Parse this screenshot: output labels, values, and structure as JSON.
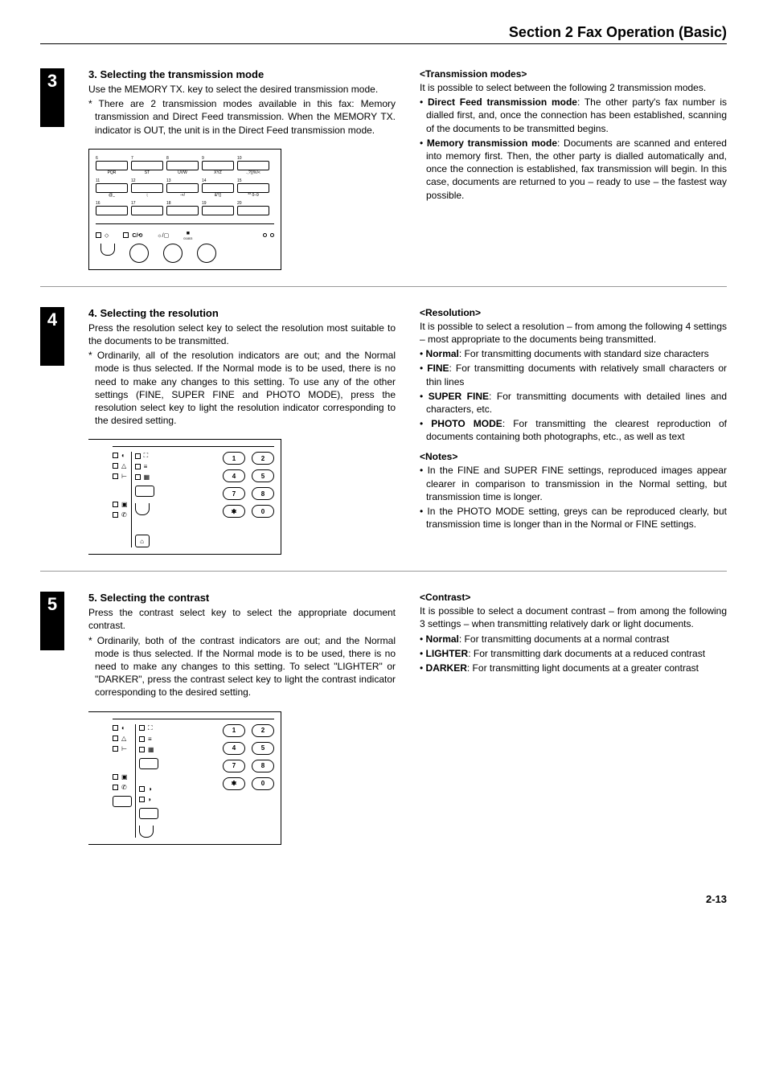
{
  "header": "Section 2   Fax Operation (Basic)",
  "step3": {
    "num": "3",
    "title": "3. Selecting the transmission mode",
    "body": "Use the MEMORY TX. key to select the desired transmission mode.",
    "note": "* There are 2 transmission modes available in this fax: Memory transmission and Direct Feed transmission. When the MEMORY TX. indicator is OUT, the unit is in the Direct Feed transmission mode.",
    "right_title": "<Transmission modes>",
    "right_intro": "It is possible to select between the following 2 transmission modes.",
    "bullets": [
      {
        "b": "Direct Feed transmission mode",
        "t": ": The other party's fax number is dialled first, and, once the connection has been established, scanning of the documents to be transmitted begins."
      },
      {
        "b": "Memory transmission mode",
        "t": ": Documents are scanned and entered into memory first. Then, the other party is dialled automatically and, once the connection is established, fax transmission will begin. In this case, documents are returned to you – ready to use – the fastest way possible."
      }
    ]
  },
  "step4": {
    "num": "4",
    "title": "4. Selecting the resolution",
    "body": "Press the resolution select key to select the resolution most suitable to the documents to be transmitted.",
    "note": "* Ordinarily, all of the resolution indicators are out; and the Normal mode is thus selected. If the Normal mode is to be used, there is no need to make any changes to this setting. To use any of the other settings (FINE, SUPER FINE and PHOTO MODE), press the resolution select key to light the resolution indicator corresponding to the desired setting.",
    "right_title": "<Resolution>",
    "right_intro": "It is possible to select a resolution – from among the following 4 settings – most appropriate to the documents being transmitted.",
    "bullets": [
      {
        "b": "Normal",
        "t": ": For transmitting documents with standard size characters"
      },
      {
        "b": "FINE",
        "t": ": For transmitting documents with relatively small characters or thin lines"
      },
      {
        "b": "SUPER FINE",
        "t": ": For transmitting documents with detailed lines and characters, etc."
      },
      {
        "b": "PHOTO MODE",
        "t": ": For transmitting the clearest reproduction of documents containing both photographs, etc., as well as text"
      }
    ],
    "notes_title": "<Notes>",
    "notes": [
      "In the FINE and SUPER FINE settings, reproduced images appear clearer in comparison to transmission in the Normal setting, but transmission time is longer.",
      "In the PHOTO MODE setting, greys can be reproduced clearly, but transmission time is longer than in the Normal or FINE settings."
    ]
  },
  "step5": {
    "num": "5",
    "title": "5. Selecting the contrast",
    "body": "Press the contrast select key to select the appropriate document contrast.",
    "note": "* Ordinarily, both of the contrast indicators are out; and the Normal mode is thus selected. If the Normal mode is to be used, there is no need to make any changes to this setting. To select \"LIGHTER\" or \"DARKER\", press the contrast select key to light the contrast indicator corresponding to the desired setting.",
    "right_title": "<Contrast>",
    "right_intro": "It is possible to select a document contrast – from among the following 3 settings – when transmitting relatively dark or light documents.",
    "bullets": [
      {
        "b": "Normal",
        "t": ": For transmitting documents at a normal contrast"
      },
      {
        "b": "LIGHTER",
        "t": ": For transmitting dark documents at a reduced contrast"
      },
      {
        "b": "DARKER",
        "t": ": For transmitting light documents at a greater contrast"
      }
    ]
  },
  "page_num": "2-13",
  "keypad": {
    "row1": [
      {
        "n": "6",
        "l": "PQR"
      },
      {
        "n": "7",
        "l": "ST"
      },
      {
        "n": "8",
        "l": "UVW"
      },
      {
        "n": "9",
        "l": "XYZ"
      },
      {
        "n": "10",
        "l": ".,?()%!<"
      }
    ],
    "row2": [
      {
        "n": "11",
        "l": "@_"
      },
      {
        "n": "12",
        "l": ":;"
      },
      {
        "n": "13",
        "l": "-+/"
      },
      {
        "n": "14",
        "l": "&*()"
      },
      {
        "n": "15",
        "l": "** 0–9"
      }
    ],
    "row3": [
      {
        "n": "16",
        "l": ""
      },
      {
        "n": "17",
        "l": ""
      },
      {
        "n": "18",
        "l": ""
      },
      {
        "n": "19",
        "l": ""
      },
      {
        "n": "20",
        "l": ""
      }
    ]
  },
  "numkeys": [
    [
      "1",
      "2"
    ],
    [
      "4",
      "5"
    ],
    [
      "7",
      "8"
    ],
    [
      "✱",
      "0"
    ]
  ]
}
